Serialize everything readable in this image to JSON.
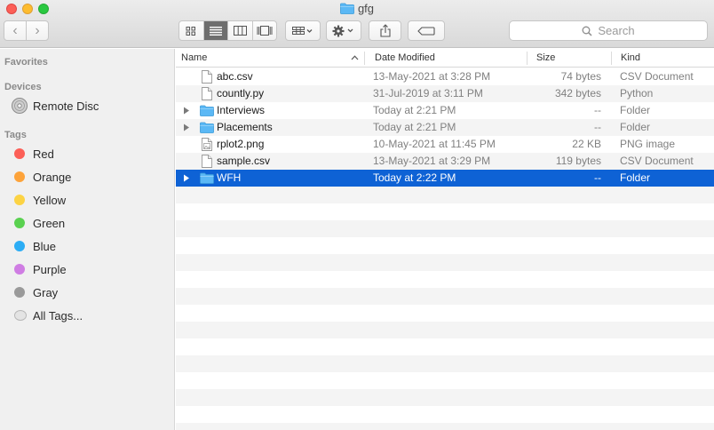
{
  "window": {
    "title": "gfg"
  },
  "toolbar": {
    "search_placeholder": "Search"
  },
  "sidebar": {
    "favorites_label": "Favorites",
    "devices_label": "Devices",
    "devices": [
      {
        "label": "Remote Disc",
        "icon": "disc-icon"
      }
    ],
    "tags_label": "Tags",
    "tags": [
      {
        "label": "Red",
        "color": "#fc5f57"
      },
      {
        "label": "Orange",
        "color": "#fda33a"
      },
      {
        "label": "Yellow",
        "color": "#fcd344"
      },
      {
        "label": "Green",
        "color": "#5ad150"
      },
      {
        "label": "Blue",
        "color": "#2cadf5"
      },
      {
        "label": "Purple",
        "color": "#cf7de3"
      },
      {
        "label": "Gray",
        "color": "#9a9a9a"
      },
      {
        "label": "All Tags...",
        "color": ""
      }
    ]
  },
  "columns": {
    "name": "Name",
    "date": "Date Modified",
    "size": "Size",
    "kind": "Kind"
  },
  "files": [
    {
      "name": "abc.csv",
      "date": "13-May-2021 at 3:28 PM",
      "size": "74 bytes",
      "kind": "CSV Document",
      "icon": "document-icon",
      "expandable": false,
      "selected": false
    },
    {
      "name": "countly.py",
      "date": "31-Jul-2019 at 3:11 PM",
      "size": "342 bytes",
      "kind": "Python",
      "icon": "document-icon",
      "expandable": false,
      "selected": false
    },
    {
      "name": "Interviews",
      "date": "Today at 2:21 PM",
      "size": "--",
      "kind": "Folder",
      "icon": "folder-icon",
      "expandable": true,
      "selected": false
    },
    {
      "name": "Placements",
      "date": "Today at 2:21 PM",
      "size": "--",
      "kind": "Folder",
      "icon": "folder-icon",
      "expandable": true,
      "selected": false
    },
    {
      "name": "rplot2.png",
      "date": "10-May-2021 at 11:45 PM",
      "size": "22 KB",
      "kind": "PNG image",
      "icon": "image-icon",
      "expandable": false,
      "selected": false
    },
    {
      "name": "sample.csv",
      "date": "13-May-2021 at 3:29 PM",
      "size": "119 bytes",
      "kind": "CSV Document",
      "icon": "document-icon",
      "expandable": false,
      "selected": false
    },
    {
      "name": "WFH",
      "date": "Today at 2:22 PM",
      "size": "--",
      "kind": "Folder",
      "icon": "folder-icon",
      "expandable": true,
      "selected": true
    }
  ]
}
